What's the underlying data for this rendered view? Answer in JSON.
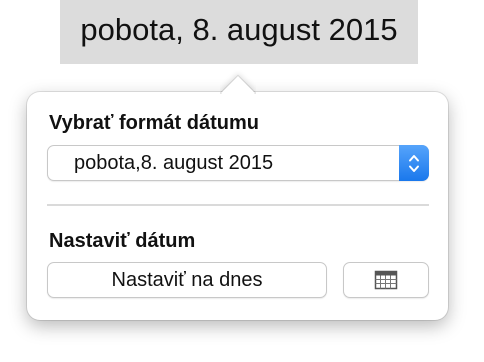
{
  "document": {
    "selected_date_text": "pobota, 8. august 2015"
  },
  "popover": {
    "format_section_label": "Vybrať formát dátumu",
    "format_select_value": "pobota,8. august 2015",
    "date_section_label": "Nastaviť dátum",
    "today_button_label": "Nastaviť na dnes",
    "calendar_button_icon": "calendar-icon"
  },
  "colors": {
    "stepper_accent": "#1a78ec",
    "selection_highlight": "#dcdcdc"
  }
}
